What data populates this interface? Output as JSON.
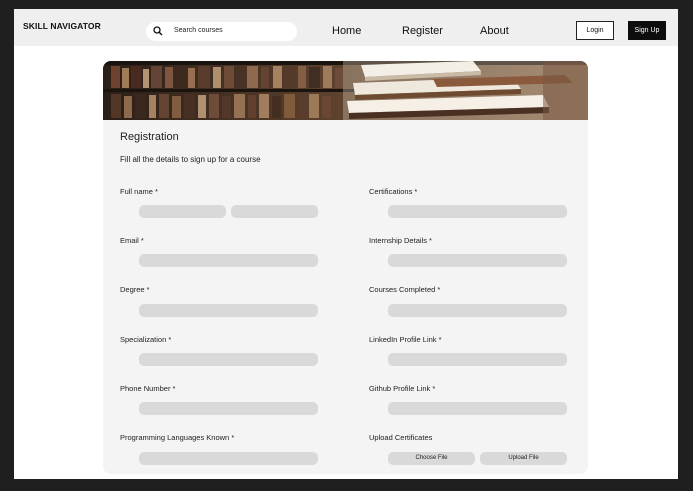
{
  "header": {
    "brand": "SKILL NAVIGATOR",
    "search_placeholder": "Search courses",
    "nav": [
      "Home",
      "Register",
      "About"
    ],
    "login_label": "Login",
    "signup_label": "Sign Up"
  },
  "form": {
    "title": "Registration",
    "subtitle": "Fill all the details to sign up for a course",
    "left_labels": {
      "full_name": "Full name *",
      "email": "Email *",
      "degree": "Degree *",
      "specialization": "Specialization *",
      "phone": "Phone Number *",
      "languages": "Programming Languages Known *"
    },
    "right_labels": {
      "certifications": "Certifications *",
      "internship": "Internship Details *",
      "courses": "Courses Completed *",
      "linkedin": "LinkedIn Profile Link *",
      "github": "Github Profile Link *",
      "upload": "Upload Certificates"
    },
    "choose_file_label": "Choose File",
    "upload_file_label": "Upload File"
  },
  "colors": {
    "page_bg": "#1f1f1f",
    "navbar_bg": "#efefef",
    "card_bg": "#f4f4f4",
    "field_bg": "#d9d9d9",
    "signup_bg": "#0d0d0d"
  }
}
